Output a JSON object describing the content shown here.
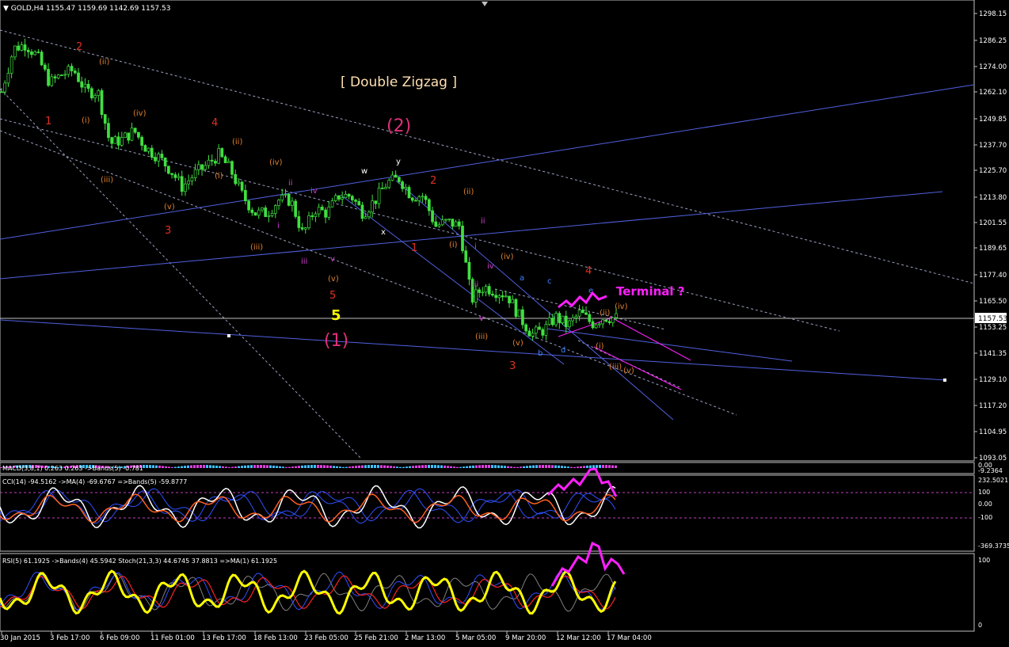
{
  "header": {
    "symbol_line": "GOLD,H4  1155.47 1159.69 1142.69 1157.53"
  },
  "main_panel": {
    "price_ticks": [
      "1298.15",
      "1286.25",
      "1274.00",
      "1262.10",
      "1249.85",
      "1237.70",
      "1225.70",
      "1213.80",
      "1201.55",
      "1189.65",
      "1177.40",
      "1165.50",
      "1153.25",
      "1141.35",
      "1129.10",
      "1117.20",
      "1104.95",
      "1093.05"
    ],
    "current_price": "1157.53",
    "title": "[ Double Zigzag ]",
    "terminal_label": "Terminal ?",
    "big_labels": [
      {
        "id": "wave-1-major",
        "text": "(1)"
      },
      {
        "id": "wave-2-major",
        "text": "(2)"
      },
      {
        "id": "wave-5-yellow",
        "text": "5"
      }
    ]
  },
  "macd_panel": {
    "label": "MACD(3,8,1) 0.263 0.263 ->Bands(5) -0.781",
    "ticks": [
      "0.00",
      "-9.2364"
    ]
  },
  "cci_panel": {
    "label": "CCI(14) -94.5162  ->MA(4) -69.6767  =>Bands(5) -59.8777",
    "ticks": [
      "232.5021",
      "100",
      "0.00",
      "-100",
      "-369.3735"
    ]
  },
  "rsi_panel": {
    "label": "RSI(5) 61.1925  ->Bands(4) 45.5942  Stoch(21,3,3) 44.6745 37.8813  =>MA(1) 61.1925",
    "ticks": [
      "100",
      "0"
    ]
  },
  "time_axis": [
    "30 Jan 2015",
    "3 Feb 17:00",
    "6 Feb 09:00",
    "11 Feb 01:00",
    "13 Feb 17:00",
    "18 Feb 13:00",
    "23 Feb 05:00",
    "25 Feb 21:00",
    "2 Mar 13:00",
    "5 Mar 05:00",
    "9 Mar 20:00",
    "12 Mar 12:00",
    "17 Mar 04:00"
  ],
  "wave_labels": [
    {
      "t": "2",
      "c": "#e03020"
    },
    {
      "t": "(ii)",
      "c": "#e08030"
    },
    {
      "t": "1",
      "c": "#e03020"
    },
    {
      "t": "(i)",
      "c": "#e08030"
    },
    {
      "t": "(iv)",
      "c": "#e08030"
    },
    {
      "t": "(iii)",
      "c": "#e08030"
    },
    {
      "t": "4",
      "c": "#e03020"
    },
    {
      "t": "(ii)",
      "c": "#e08030"
    },
    {
      "t": "(i)",
      "c": "#e08030"
    },
    {
      "t": "(v)",
      "c": "#e08030"
    },
    {
      "t": "3",
      "c": "#e03020"
    },
    {
      "t": "(iv)",
      "c": "#e08030"
    },
    {
      "t": "ii",
      "c": "#d040d0"
    },
    {
      "t": "iv",
      "c": "#d040d0"
    },
    {
      "t": "i",
      "c": "#d040d0"
    },
    {
      "t": "(iii)",
      "c": "#e08030"
    },
    {
      "t": "iii",
      "c": "#d040d0"
    },
    {
      "t": "v",
      "c": "#d040d0"
    },
    {
      "t": "(v)",
      "c": "#e08030"
    },
    {
      "t": "5",
      "c": "#e03020"
    },
    {
      "t": "w",
      "c": "#ffffff"
    },
    {
      "t": "y",
      "c": "#ffffff"
    },
    {
      "t": "x",
      "c": "#ffffff"
    },
    {
      "t": "2",
      "c": "#e03020"
    },
    {
      "t": "(ii)",
      "c": "#e08030"
    },
    {
      "t": "1",
      "c": "#e03020"
    },
    {
      "t": "(i)",
      "c": "#e08030"
    },
    {
      "t": "ii",
      "c": "#d040d0"
    },
    {
      "t": "i",
      "c": "#d040d0"
    },
    {
      "t": "iv",
      "c": "#d040d0"
    },
    {
      "t": "(iv)",
      "c": "#e08030"
    },
    {
      "t": "iii",
      "c": "#d040d0"
    },
    {
      "t": "v",
      "c": "#d040d0"
    },
    {
      "t": "(iii)",
      "c": "#e08030"
    },
    {
      "t": "(v)",
      "c": "#e08030"
    },
    {
      "t": "3",
      "c": "#e03020"
    },
    {
      "t": "a",
      "c": "#4080ff"
    },
    {
      "t": "c",
      "c": "#4080ff"
    },
    {
      "t": "b",
      "c": "#4080ff"
    },
    {
      "t": "d",
      "c": "#4080ff"
    },
    {
      "t": "e",
      "c": "#4080ff"
    },
    {
      "t": "4",
      "c": "#e03020"
    },
    {
      "t": "(iv)",
      "c": "#e08030"
    },
    {
      "t": "(ii)",
      "c": "#e08030"
    },
    {
      "t": "(i)",
      "c": "#e08030"
    },
    {
      "t": "(iii)",
      "c": "#e08030"
    },
    {
      "t": "(v)",
      "c": "#e08030"
    }
  ],
  "colors": {
    "candle": "#40e040",
    "trendline": "#5060e0",
    "dashed": "#9aa0c0",
    "magenta": "#ff20ff",
    "pink_label": "#e0307a",
    "yellow": "#ffff00",
    "title": "#ffe0b0"
  },
  "chart_data": {
    "type": "candlestick",
    "title": "GOLD,H4",
    "ylim": [
      1093.05,
      1298.15
    ],
    "close_path": [
      1262,
      1282,
      1284,
      1278,
      1266,
      1270,
      1272,
      1262,
      1262,
      1238,
      1240,
      1244,
      1236,
      1232,
      1226,
      1218,
      1224,
      1228,
      1233,
      1226,
      1214,
      1206,
      1206,
      1212,
      1212,
      1196,
      1208,
      1206,
      1214,
      1214,
      1206,
      1212,
      1220,
      1222,
      1214,
      1214,
      1200,
      1202,
      1200,
      1166,
      1172,
      1170,
      1168,
      1158,
      1150,
      1152,
      1158,
      1154,
      1160,
      1155,
      1158,
      1157.53
    ],
    "last": {
      "open": 1155.47,
      "high": 1159.69,
      "low": 1142.69,
      "close": 1157.53
    }
  }
}
